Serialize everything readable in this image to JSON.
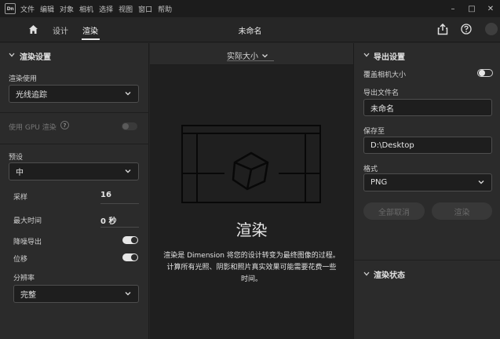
{
  "app": {
    "logo": "Dn"
  },
  "menubar": {
    "items": [
      "文件",
      "编辑",
      "对象",
      "相机",
      "选择",
      "视图",
      "窗口",
      "帮助"
    ]
  },
  "window_controls": {
    "minimize": "–",
    "maximize": "□",
    "close": "✕"
  },
  "topbar": {
    "tabs": [
      {
        "label": "设计"
      },
      {
        "label": "渲染",
        "active": true
      }
    ],
    "document_title": "未命名"
  },
  "left_panel": {
    "title": "渲染设置",
    "render_using_label": "渲染使用",
    "render_using_value": "光线追踪",
    "gpu_label": "使用 GPU 渲染",
    "preset_label": "预设",
    "preset_value": "中",
    "samples_label": "采样",
    "samples_value": "16",
    "max_time_label": "最大时间",
    "max_time_value": "0 秒",
    "denoise_label": "降噪导出",
    "denoise_on": true,
    "displacement_label": "位移",
    "displacement_on": true,
    "resolution_label": "分辨率",
    "resolution_value": "完整"
  },
  "center": {
    "zoom_label": "实际大小",
    "heading": "渲染",
    "description_line1": "渲染是 Dimension 将您的设计转变为最终图像的过程。",
    "description_line2": "计算所有光照、阴影和照片真实效果可能需要花费一些",
    "description_line3": "时间。"
  },
  "right_panel": {
    "title": "导出设置",
    "overlay_camera_label": "覆盖相机大小",
    "overlay_camera_on": false,
    "filename_label": "导出文件名",
    "filename_value": "未命名",
    "save_to_label": "保存至",
    "save_to_value": "D:\\Desktop",
    "format_label": "格式",
    "format_value": "PNG",
    "cancel_all_label": "全部取消",
    "render_label": "渲染",
    "status_title": "渲染状态"
  },
  "colors": {
    "background": "#262626",
    "panel": "#2b2b2b",
    "canvas": "#1f1f1f",
    "accent": "#e6e6e6"
  },
  "icons": {
    "home": "home-icon",
    "share": "share-icon",
    "help": "help-icon",
    "chevron": "chevron-down-icon",
    "cube": "cube-icon"
  }
}
